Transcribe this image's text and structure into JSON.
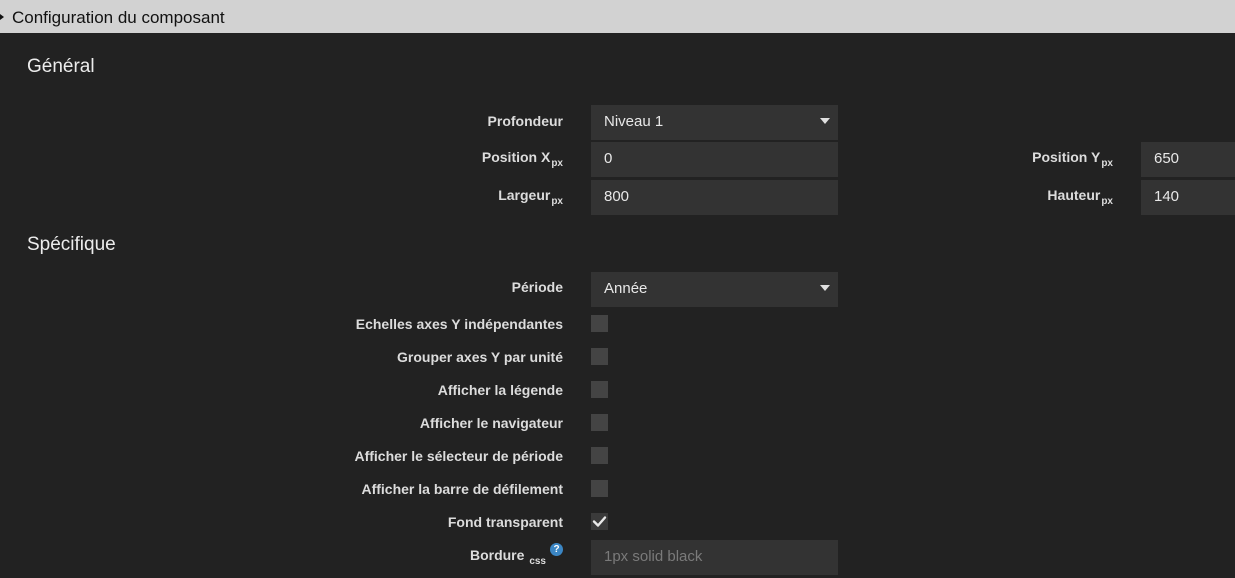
{
  "header": {
    "title": "Configuration du composant"
  },
  "general": {
    "title": "Général",
    "depth": {
      "label": "Profondeur",
      "value": "Niveau 1"
    },
    "position_x": {
      "label": "Position X",
      "unit": "px",
      "value": "0"
    },
    "position_y": {
      "label": "Position Y",
      "unit": "px",
      "value": "650"
    },
    "width": {
      "label": "Largeur",
      "unit": "px",
      "value": "800"
    },
    "height": {
      "label": "Hauteur",
      "unit": "px",
      "value": "140"
    }
  },
  "specific": {
    "title": "Spécifique",
    "period": {
      "label": "Période",
      "value": "Année"
    },
    "checkboxes": [
      {
        "label": "Echelles axes Y indépendantes",
        "checked": false
      },
      {
        "label": "Grouper axes Y par unité",
        "checked": false
      },
      {
        "label": "Afficher la légende",
        "checked": false
      },
      {
        "label": "Afficher le navigateur",
        "checked": false
      },
      {
        "label": "Afficher le sélecteur de période",
        "checked": false
      },
      {
        "label": "Afficher la barre de défilement",
        "checked": false
      },
      {
        "label": "Fond transparent",
        "checked": true
      }
    ],
    "border": {
      "label": "Bordure",
      "unit": "css",
      "placeholder": "1px solid black",
      "help_icon": "?"
    }
  }
}
